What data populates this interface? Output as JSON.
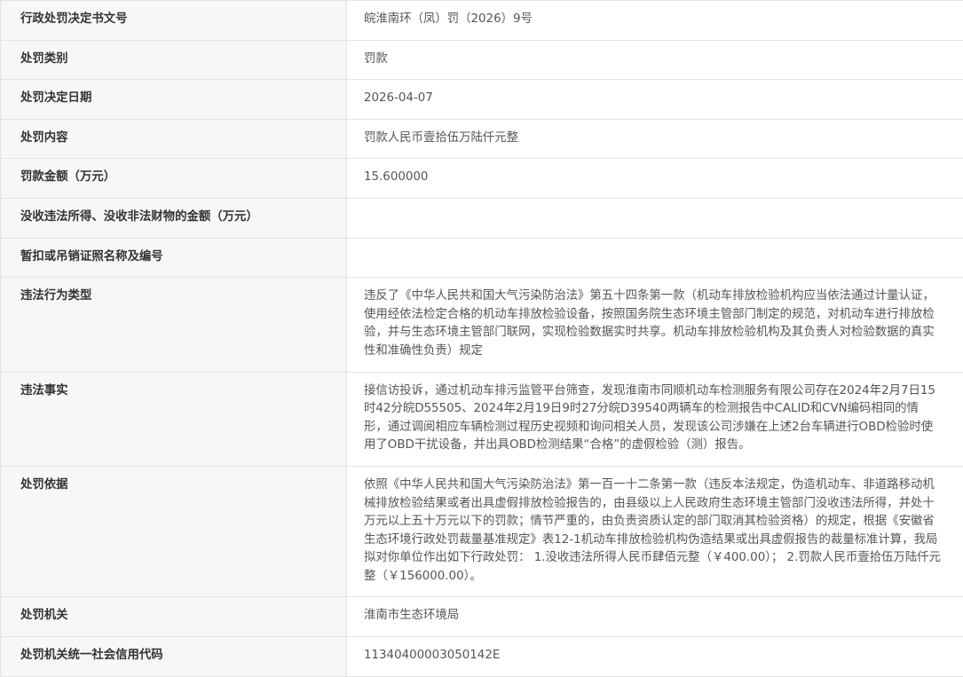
{
  "rows": [
    {
      "label": "行政处罚决定书文号",
      "value": "皖淮南环（凤）罚（2026）9号"
    },
    {
      "label": "处罚类别",
      "value": "罚款"
    },
    {
      "label": "处罚决定日期",
      "value": "2026-04-07"
    },
    {
      "label": "处罚内容",
      "value": "罚款人民币壹拾伍万陆仟元整"
    },
    {
      "label": "罚款金额（万元）",
      "value": "15.600000"
    },
    {
      "label": "没收违法所得、没收非法财物的金额（万元）",
      "value": ""
    },
    {
      "label": "暂扣或吊销证照名称及编号",
      "value": ""
    },
    {
      "label": "违法行为类型",
      "value": "违反了《中华人民共和国大气污染防治法》第五十四条第一款（机动车排放检验机构应当依法通过计量认证，使用经依法检定合格的机动车排放检验设备，按照国务院生态环境主管部门制定的规范，对机动车进行排放检验，并与生态环境主管部门联网，实现检验数据实时共享。机动车排放检验机构及其负责人对检验数据的真实性和准确性负责）规定"
    },
    {
      "label": "违法事实",
      "value": "接信访投诉，通过机动车排污监管平台筛查，发现淮南市同顺机动车检测服务有限公司存在2024年2月7日15时42分皖D55505、2024年2月19日9时27分皖D39540两辆车的检测报告中CALID和CVN编码相同的情形，通过调阅相应车辆检测过程历史视频和询问相关人员，发现该公司涉嫌在上述2台车辆进行OBD检验时使用了OBD干扰设备，并出具OBD检测结果“合格”的虚假检验（测）报告。"
    },
    {
      "label": "处罚依据",
      "value": "依照《中华人民共和国大气污染防治法》第一百一十二条第一款（违反本法规定，伪造机动车、非道路移动机械排放检验结果或者出具虚假排放检验报告的，由县级以上人民政府生态环境主管部门没收违法所得，并处十万元以上五十万元以下的罚款；情节严重的，由负责资质认定的部门取消其检验资格）的规定，根据《安徽省生态环境行政处罚裁量基准规定》表12-1机动车排放检验机构伪造结果或出具虚假报告的裁量标准计算，我局拟对你单位作出如下行政处罚： 1.没收违法所得人民币肆佰元整（￥400.00）； 2.罚款人民币壹拾伍万陆仟元整（￥156000.00）。"
    },
    {
      "label": "处罚机关",
      "value": "淮南市生态环境局"
    },
    {
      "label": "处罚机关统一社会信用代码",
      "value": "11340400003050142E"
    }
  ]
}
